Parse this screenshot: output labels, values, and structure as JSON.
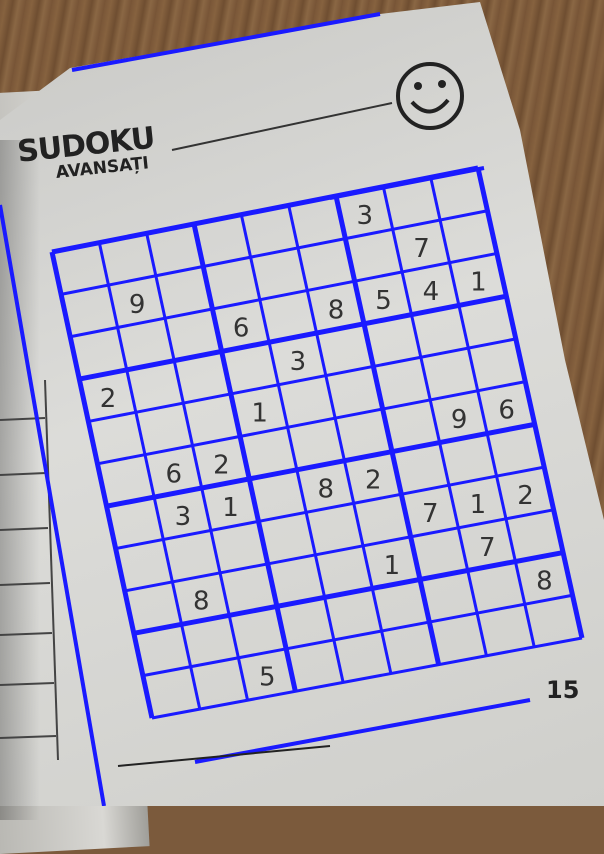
{
  "logo": {
    "title": "SUDOKU",
    "subtitle": "AVANSAȚI"
  },
  "page_number": "15",
  "smiley_icon": "smiley-face-icon",
  "colors": {
    "overlay_lines": "#1a1aff",
    "ink": "#333333"
  },
  "puzzle": {
    "rows": 9,
    "cols": 9,
    "givens": [
      {
        "r": 0,
        "c": 6,
        "v": "3"
      },
      {
        "r": 1,
        "c": 1,
        "v": "9"
      },
      {
        "r": 1,
        "c": 7,
        "v": "7"
      },
      {
        "r": 2,
        "c": 3,
        "v": "6"
      },
      {
        "r": 2,
        "c": 5,
        "v": "8"
      },
      {
        "r": 2,
        "c": 6,
        "v": "5"
      },
      {
        "r": 2,
        "c": 7,
        "v": "4"
      },
      {
        "r": 2,
        "c": 8,
        "v": "1"
      },
      {
        "r": 3,
        "c": 0,
        "v": "2"
      },
      {
        "r": 3,
        "c": 4,
        "v": "3"
      },
      {
        "r": 4,
        "c": 3,
        "v": "1"
      },
      {
        "r": 5,
        "c": 1,
        "v": "6"
      },
      {
        "r": 5,
        "c": 2,
        "v": "2"
      },
      {
        "r": 5,
        "c": 7,
        "v": "9"
      },
      {
        "r": 5,
        "c": 8,
        "v": "6"
      },
      {
        "r": 6,
        "c": 1,
        "v": "3"
      },
      {
        "r": 6,
        "c": 2,
        "v": "1"
      },
      {
        "r": 6,
        "c": 4,
        "v": "8"
      },
      {
        "r": 6,
        "c": 5,
        "v": "2"
      },
      {
        "r": 7,
        "c": 6,
        "v": "7"
      },
      {
        "r": 7,
        "c": 7,
        "v": "1"
      },
      {
        "r": 7,
        "c": 8,
        "v": "2"
      },
      {
        "r": 8,
        "c": 1,
        "v": "8"
      },
      {
        "r": 8,
        "c": 5,
        "v": "1"
      },
      {
        "r": 8,
        "c": 7,
        "v": "7"
      },
      {
        "r": 9,
        "c": 8,
        "v": "8"
      },
      {
        "r": 10,
        "c": 2,
        "v": "5"
      }
    ]
  }
}
